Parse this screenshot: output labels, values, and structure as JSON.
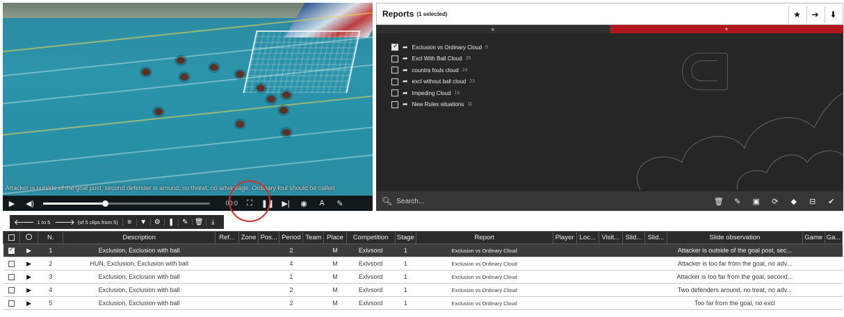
{
  "video": {
    "caption": "Attacker is outside of the goal post, second defender is around, no threat, no advantage. Ordinary foul should be called",
    "timecode": "00:0",
    "progress": 0.37,
    "controls": [
      "play-icon",
      "volume-icon",
      "fullscreen-icon",
      "pause-icon",
      "next-icon",
      "eye-icon",
      "text-icon",
      "pencil-icon"
    ]
  },
  "reports": {
    "title": "Reports",
    "selected_note": "(1 selected)",
    "header_buttons": [
      "star-icon",
      "arrow-right-icon",
      "arrow-down-icon"
    ],
    "tab_left": "●",
    "tab_right": "+",
    "items": [
      {
        "label": "Exclusion vs Ordinary Cloud",
        "count": "5",
        "checked": true
      },
      {
        "label": "Excl With Ball Cloud",
        "count": "25",
        "checked": false
      },
      {
        "label": "countra fouls cloud",
        "count": "24",
        "checked": false
      },
      {
        "label": "excl without ball cloud",
        "count": "23",
        "checked": false
      },
      {
        "label": "Impeding Cloud",
        "count": "16",
        "checked": false
      },
      {
        "label": "New Rules situations",
        "count": "11",
        "checked": false
      }
    ],
    "search_placeholder": "Search...",
    "tools": [
      "trash-icon",
      "pencil-icon",
      "image-icon",
      "refresh-icon",
      "tag-icon",
      "minus-icon",
      "check-icon"
    ]
  },
  "toolbar": {
    "range": "1 to 5",
    "clips": "(of 5 clips from 5)",
    "buttons": [
      "list-icon",
      "filter-icon",
      "gear-icon",
      "bookmark-icon",
      "pencil-icon",
      "trash-icon",
      "download-icon"
    ]
  },
  "table": {
    "columns": [
      "",
      "",
      "N.",
      "Description",
      "Ref...",
      "Zone",
      "Pos...",
      "Period",
      "Team",
      "Place",
      "Competition",
      "Stage",
      "Report",
      "Player",
      "Loc...",
      "Visit...",
      "Slid...",
      "Slid...",
      "Slide observation",
      "Game",
      "Ga..."
    ],
    "rows": [
      {
        "n": "1",
        "description": "Exclusion, Exclusion with ball",
        "period": "2",
        "place": "M",
        "competition": "Exlvsord",
        "stage": "1",
        "report": "Exclusion vs Ordinary Cloud",
        "observation": "Attacker is outside of the goal post, sec...",
        "selected": true
      },
      {
        "n": "2",
        "description": "HUN, Exclusion, Exclusion with ball",
        "period": "4",
        "place": "M",
        "competition": "Exlvsord",
        "stage": "1",
        "report": "Exclusion vs Ordinary Cloud",
        "observation": "Attacker is too far from the goal, no adv...",
        "selected": false
      },
      {
        "n": "3",
        "description": "Exclusion, Exclusion with ball",
        "period": "1",
        "place": "M",
        "competition": "Exlvsord",
        "stage": "1",
        "report": "Exclusion vs Ordinary Cloud",
        "observation": "Attacker is too far from the goal, second...",
        "selected": false
      },
      {
        "n": "4",
        "description": "Exclusion, Exclusion with ball",
        "period": "2",
        "place": "M",
        "competition": "Exlvsord",
        "stage": "1",
        "report": "Exclusion vs Ordinary Cloud",
        "observation": "Two defenders around, no treat, no adv...",
        "selected": false
      },
      {
        "n": "5",
        "description": "Exclusion, Exclusion with ball",
        "period": "2",
        "place": "M",
        "competition": "Exlvsord",
        "stage": "1",
        "report": "Exclusion vs Ordinary Cloud",
        "observation": "Too far from the goal, no excl",
        "selected": false
      }
    ]
  },
  "colors": {
    "accent_red": "#b0181e",
    "dark_panel": "#262626",
    "selected_row": "#3c3c3c"
  }
}
